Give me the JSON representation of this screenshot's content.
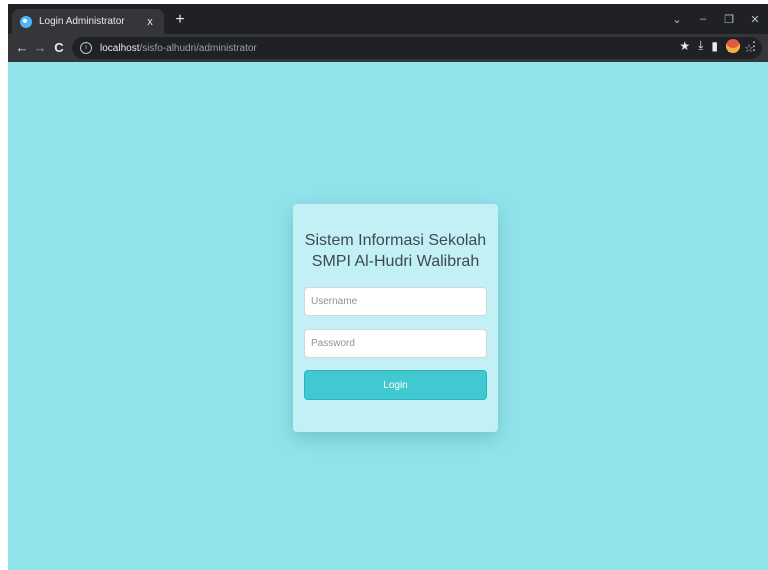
{
  "browser": {
    "tab_title": "Login Administrator",
    "tab_close": "x",
    "new_tab": "+",
    "window_controls": {
      "collapse": "⌄",
      "minimize": "–",
      "restore": "❐",
      "close": "✕"
    },
    "nav": {
      "back": "←",
      "forward": "→",
      "reload": "C"
    },
    "url_host": "localhost",
    "url_path": "/sisfo-alhudri/administrator",
    "info_icon": "i",
    "omnibox_icons": {
      "share": "⇪",
      "bookmark": "☆"
    },
    "extension_icons": {
      "extensions": "★",
      "download": "⤓",
      "side_panel": "▮",
      "menu": "⋮"
    }
  },
  "login": {
    "title_line1": "Sistem Informasi Sekolah",
    "title_line2": "SMPI Al-Hudri Walibrah",
    "username_placeholder": "Username",
    "password_placeholder": "Password",
    "button_label": "Login"
  },
  "colors": {
    "page_background": "#91e3eb",
    "card_background": "#c2f0f4",
    "button_background": "#42c8d0"
  }
}
